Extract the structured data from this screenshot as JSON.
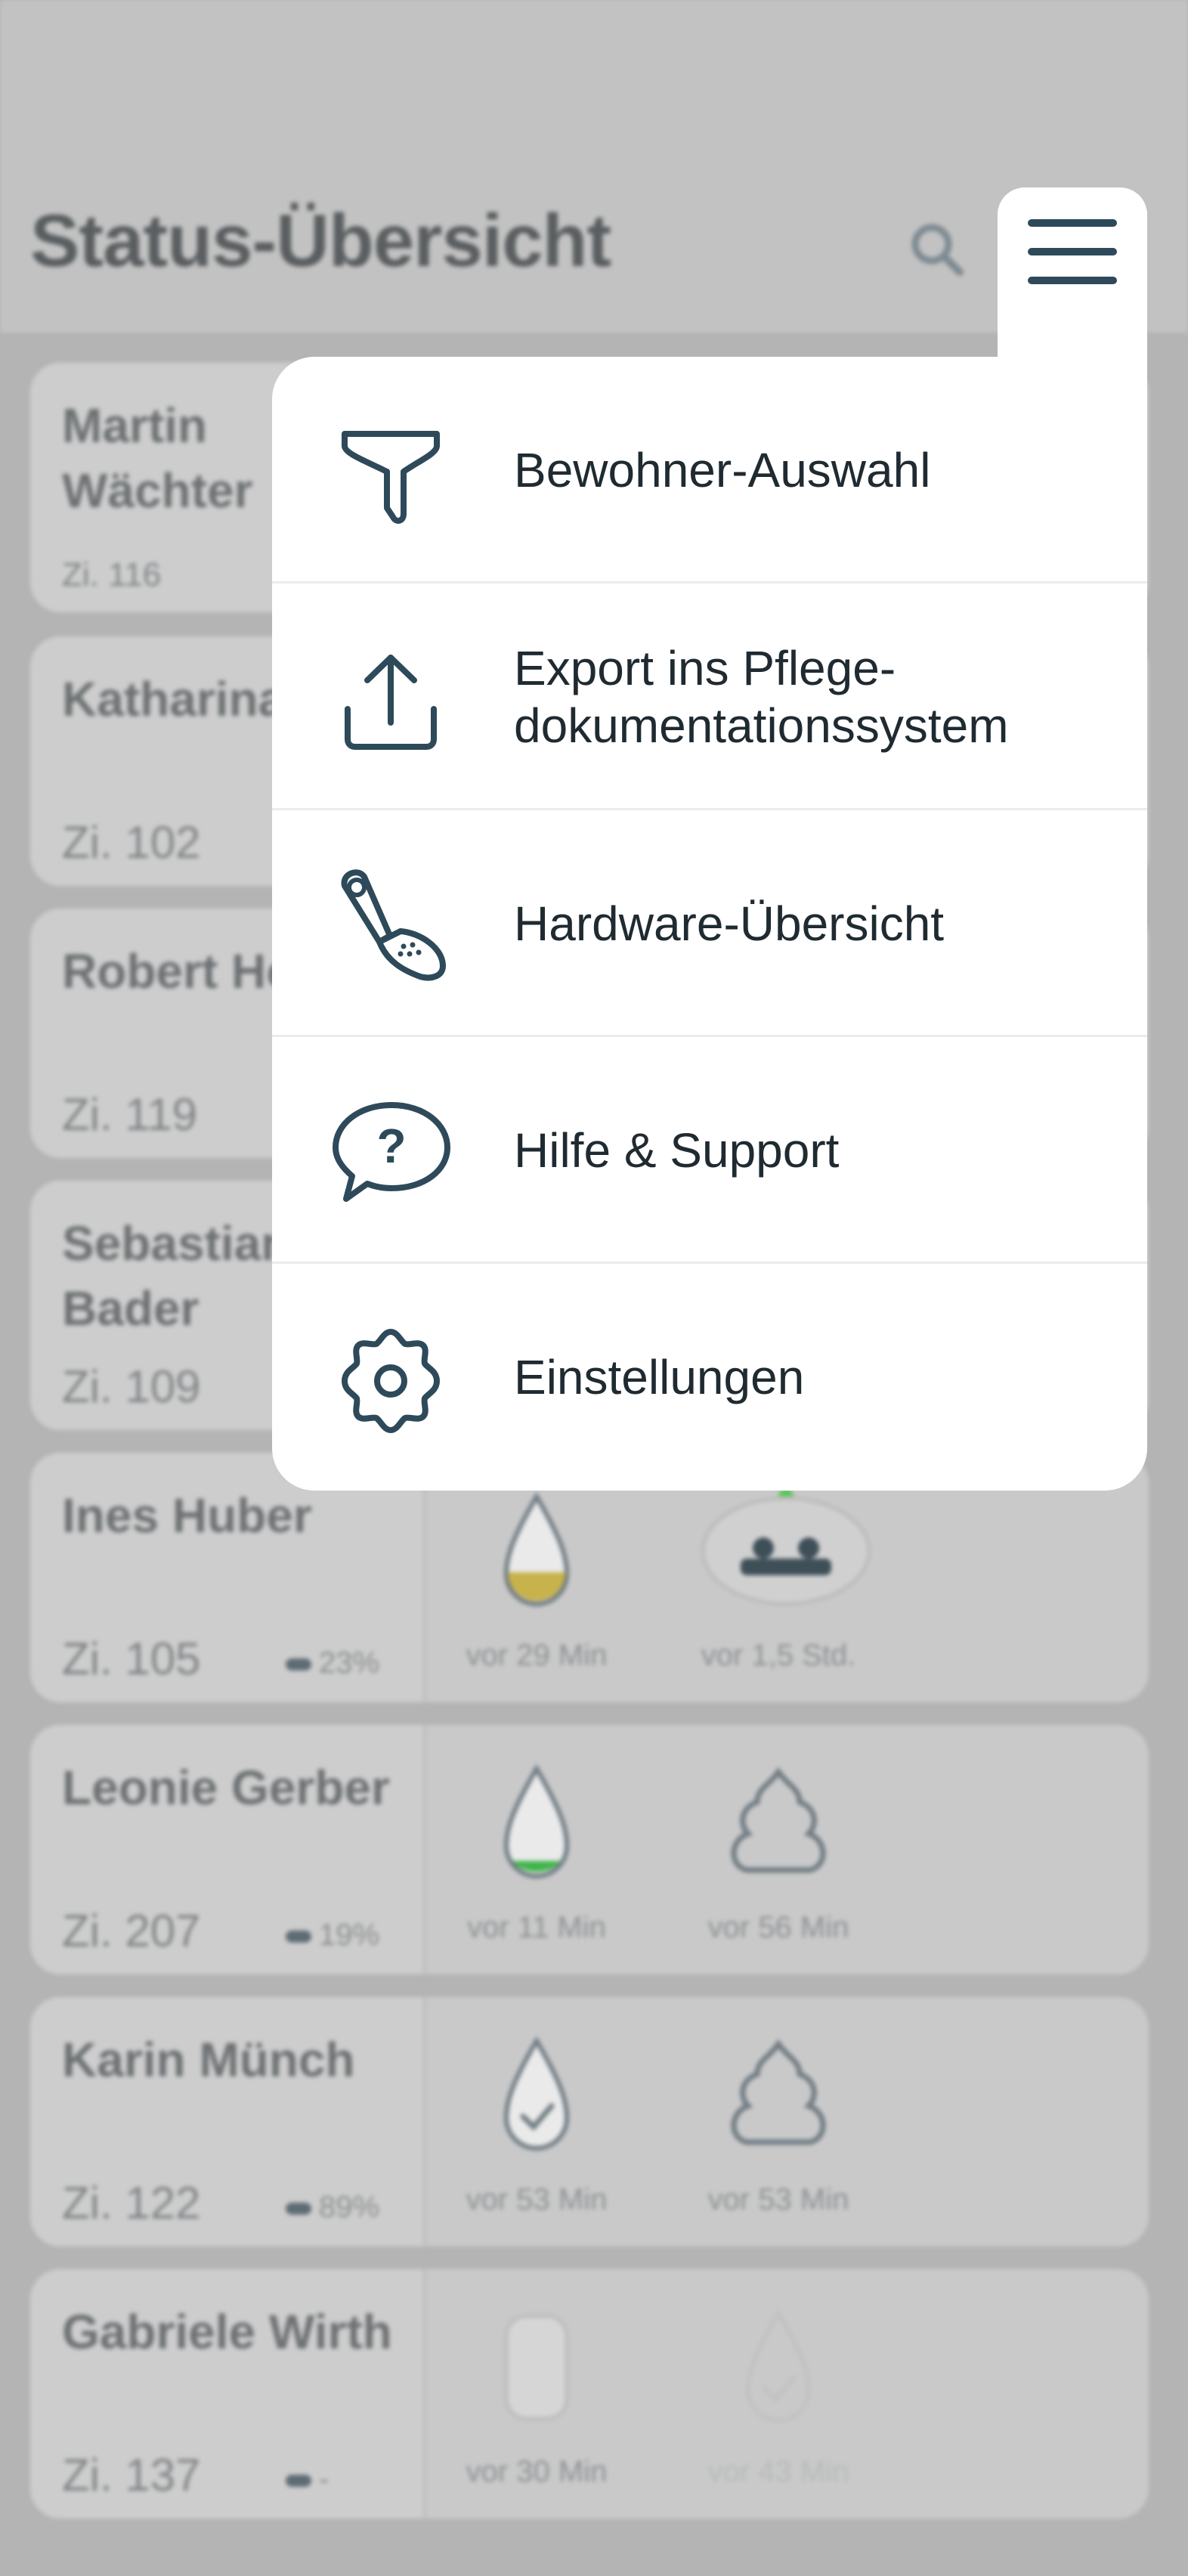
{
  "header": {
    "title": "Status-Übersicht"
  },
  "residents": [
    {
      "name": "Martin Wächter",
      "room": "Zi. 116",
      "battery": "",
      "time1": "",
      "time2": ""
    },
    {
      "name": "Katharina Bär",
      "room": "Zi. 102",
      "battery": "",
      "time1": "",
      "time2": ""
    },
    {
      "name": "Robert Hoch",
      "room": "Zi. 119",
      "battery": "",
      "time1": "",
      "time2": ""
    },
    {
      "name": "Sebastian Bader",
      "room": "Zi. 109",
      "battery": "",
      "time1": "",
      "time2": ""
    },
    {
      "name": "Ines Huber",
      "room": "Zi. 105",
      "battery": "23%",
      "time1": "vor 29 Min",
      "time2": "vor 1,5 Std."
    },
    {
      "name": "Leonie Gerber",
      "room": "Zi. 207",
      "battery": "19%",
      "time1": "vor 11 Min",
      "time2": "vor 56 Min"
    },
    {
      "name": "Karin Münch",
      "room": "Zi. 122",
      "battery": "89%",
      "time1": "vor 53 Min",
      "time2": "vor 53 Min"
    },
    {
      "name": "Gabriele Wirth",
      "room": "Zi. 137",
      "battery": "-",
      "time1": "vor 30 Min",
      "time2": "vor 43 Min"
    }
  ],
  "menu": {
    "items": [
      {
        "label": "Bewohner-Auswahl",
        "icon": "filter-icon"
      },
      {
        "label": "Export ins Pflege-\ndokumentationssystem",
        "icon": "upload-icon"
      },
      {
        "label": "Hardware-Übersicht",
        "icon": "sensor-device-icon"
      },
      {
        "label": "Hilfe & Support",
        "icon": "help-bubble-icon"
      },
      {
        "label": "Einstellungen",
        "icon": "gear-icon"
      }
    ]
  },
  "colors": {
    "accent": "#2e4a5a",
    "menu_text": "#1f2a31",
    "liquid_yellow": "#d8c04a",
    "liquid_green": "#3ecf4a"
  }
}
